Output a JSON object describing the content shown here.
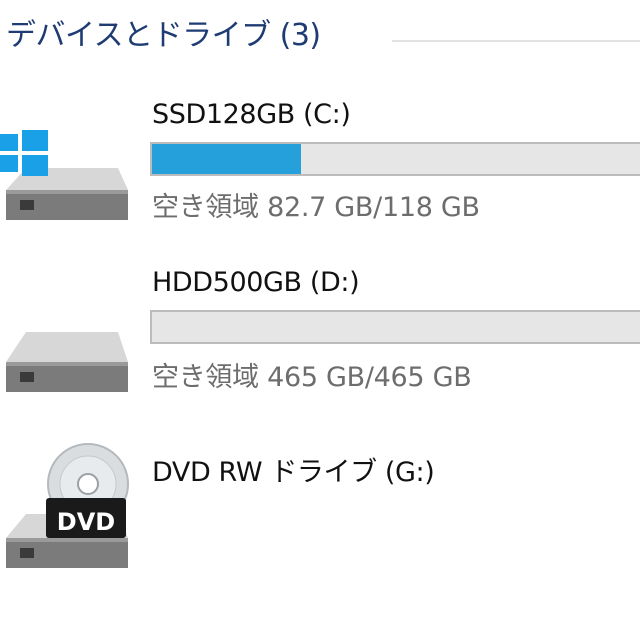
{
  "section": {
    "title": "デバイスとドライブ (3)"
  },
  "drives": [
    {
      "name": "SSD128GB (C:)",
      "free_label": "空き領域",
      "free_value": "82.7 GB/118 GB",
      "used_fraction": 0.3,
      "icon": "windows-system-drive-icon"
    },
    {
      "name": "HDD500GB (D:)",
      "free_label": "空き領域",
      "free_value": "465 GB/465 GB",
      "used_fraction": 0.0,
      "icon": "hard-drive-icon"
    },
    {
      "name": "DVD RW ドライブ (G:)",
      "icon": "dvd-drive-icon",
      "badge": "DVD"
    }
  ],
  "colors": {
    "accent": "#26a0da",
    "title": "#1f3b73",
    "windows_logo": "#1aa0e6"
  }
}
